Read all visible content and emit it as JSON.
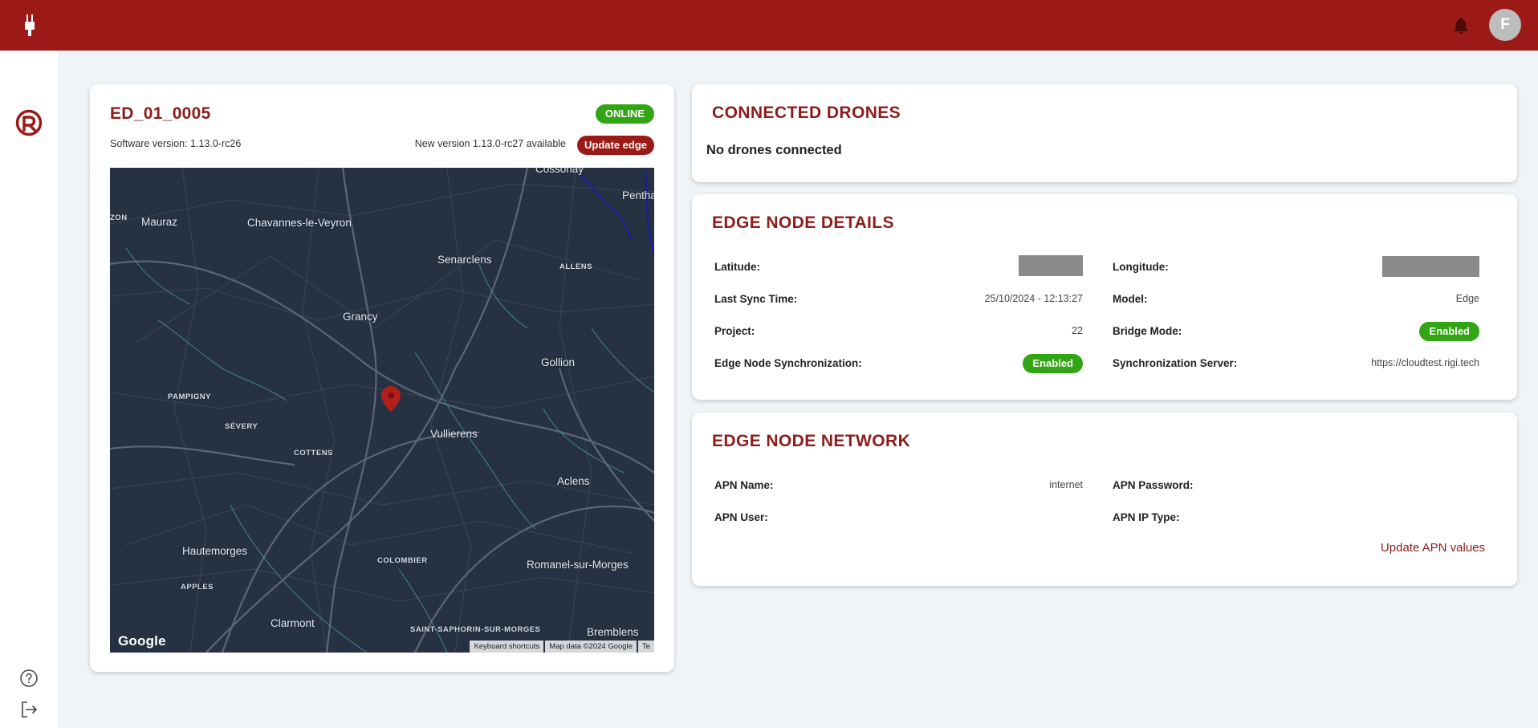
{
  "header": {
    "avatar_initial": "F",
    "brand_color": "#9b1a17"
  },
  "sidebar": {
    "logo_icon": "r-logo-icon",
    "bottom_icons": [
      "help-icon",
      "logout-icon"
    ]
  },
  "edge_card": {
    "title": "ED_01_0005",
    "status": "ONLINE",
    "software_version": "Software version: 1.13.0-rc26",
    "new_version": "New version 1.13.0-rc27 available",
    "update_button": "Update edge",
    "map": {
      "places": {
        "cossonay": "Cossonay",
        "pentha": "Pentha",
        "zon": "ZON",
        "mauraz": "Mauraz",
        "chavannes": "Chavannes-le-Veyron",
        "senarclens": "Senarclens",
        "allens": "ALLENS",
        "grancy": "Grancy",
        "gollion": "Gollion",
        "pampigny": "PAMPIGNY",
        "severy": "SÉVERY",
        "vullierens": "Vullierens",
        "cottens": "COTTENS",
        "aclens": "Aclens",
        "hautemorges": "Hautemorges",
        "colombier": "COLOMBIER",
        "romanel": "Romanel-sur-Morges",
        "apples": "APPLES",
        "clarmont": "Clarmont",
        "saint_saphorin": "SAINT-SAPHORIN-SUR-MORGES",
        "bremblens": "Bremblens"
      },
      "google_logo": "Google",
      "footer": [
        "Keyboard shortcuts",
        "Map data ©2024 Google",
        "Te"
      ]
    }
  },
  "drones_card": {
    "title": "CONNECTED DRONES",
    "empty_text": "No drones connected"
  },
  "details_card": {
    "title": "EDGE NODE DETAILS",
    "latitude_label": "Latitude:",
    "longitude_label": "Longitude:",
    "last_sync_label": "Last Sync Time:",
    "last_sync_value": "25/10/2024 - 12:13:27",
    "model_label": "Model:",
    "model_value": "Edge",
    "project_label": "Project:",
    "project_value": "22",
    "bridge_mode_label": "Bridge Mode:",
    "bridge_mode_value": "Enabled",
    "sync_label": "Edge Node Synchronization:",
    "sync_value": "Enabled",
    "sync_server_label": "Synchronization Server:",
    "sync_server_value": "https://cloudtest.rigi.tech"
  },
  "network_card": {
    "title": "EDGE NODE NETWORK",
    "apn_name_label": "APN Name:",
    "apn_name_value": "internet",
    "apn_password_label": "APN Password:",
    "apn_user_label": "APN User:",
    "apn_ip_type_label": "APN IP Type:",
    "update_link": "Update APN values"
  },
  "colors": {
    "online": "#31a513",
    "accent": "#8c1d1a",
    "map_bg": "#263241"
  }
}
